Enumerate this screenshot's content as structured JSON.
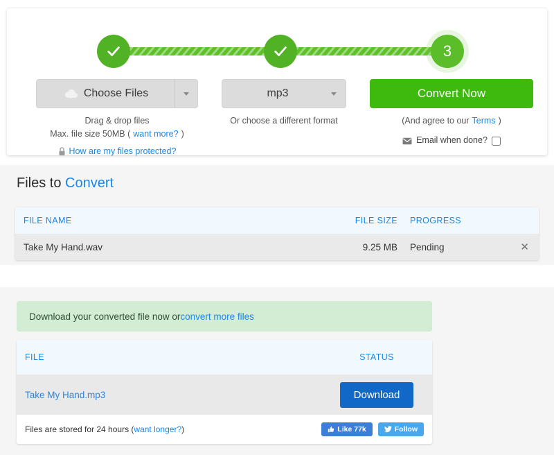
{
  "stepper": {
    "steps": [
      {
        "label": "check-complete",
        "state": "done"
      },
      {
        "label": "check-complete",
        "state": "done"
      },
      {
        "label": "3",
        "state": "current"
      }
    ],
    "current_step_number": "3"
  },
  "controls": {
    "choose_files": {
      "label": "Choose Files",
      "icon": "cloud-upload-icon",
      "caret": "▾",
      "hint_line1": "Drag & drop files",
      "hint_line2_prefix": "Max. file size 50MB (",
      "hint_line2_link": "want more?",
      "hint_line2_suffix": ")",
      "protected_link": "How are my files protected?",
      "lock_icon": "lock-icon"
    },
    "format": {
      "value": "mp3",
      "caret": "▾",
      "hint": "Or choose a different format"
    },
    "action": {
      "label": "Convert Now",
      "terms_prefix": "(And agree to our ",
      "terms_link": "Terms",
      "terms_suffix": ")",
      "email_icon": "envelope-icon",
      "email_label": "Email when done?",
      "email_checked": false
    }
  },
  "convert_section": {
    "title_plain": "Files to ",
    "title_accent": "Convert",
    "columns": [
      "FILE NAME",
      "FILE SIZE",
      "PROGRESS"
    ],
    "rows": [
      {
        "name": "Take My Hand.wav",
        "size": "9.25 MB",
        "progress": "Pending",
        "remove_icon": "✕"
      }
    ]
  },
  "download_section": {
    "notice_prefix": "Download your converted file now or ",
    "notice_link": "convert more files",
    "columns": [
      "FILE",
      "STATUS"
    ],
    "rows": [
      {
        "name": "Take My Hand.mp3",
        "action_label": "Download"
      }
    ],
    "footer": {
      "text_prefix": "Files are stored for 24 hours (",
      "text_link": "want longer?",
      "text_suffix": ")",
      "like_label": "Like 77k",
      "like_icon": "thumbs-up-icon",
      "follow_label": "Follow",
      "follow_icon": "twitter-bird-icon"
    }
  },
  "colors": {
    "green": "#3eb90d",
    "step_green": "#52b226",
    "link_blue": "#1a87e8",
    "download_blue": "#1268c7",
    "notice_green_bg": "#d3edd5",
    "header_blue_bg": "#f1f8fe"
  }
}
